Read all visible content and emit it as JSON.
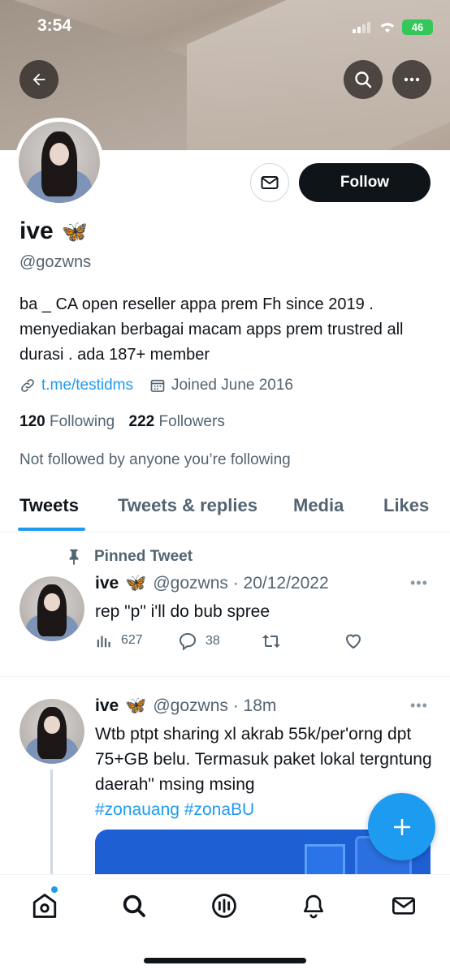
{
  "status_bar": {
    "time": "3:54",
    "battery": "46"
  },
  "profile": {
    "name": "ive",
    "name_emoji": "🦋",
    "handle": "@gozwns",
    "follow_label": "Follow",
    "bio": "ba _ CA open reseller appa prem Fh since 2019 . menyediakan berbagai macam apps prem trustred all durasi . ada 187+ member",
    "link": "t.me/testidms",
    "joined": "Joined June 2016",
    "following_count": "120",
    "following_label": "Following",
    "followers_count": "222",
    "followers_label": "Followers",
    "not_followed": "Not followed by anyone you’re following"
  },
  "tabs": [
    "Tweets",
    "Tweets & replies",
    "Media",
    "Likes"
  ],
  "tweets": [
    {
      "pinned_label": "Pinned Tweet",
      "name": "ive",
      "emoji": "🦋",
      "handle_time": "@gozwns · 20/12/2022",
      "text": "rep \"p\" i'll do bub spree",
      "views": "627",
      "replies": "38"
    },
    {
      "name": "ive",
      "emoji": "🦋",
      "handle_time": "@gozwns · 18m",
      "text": "Wtb ptpt sharing xl akrab 55k/per'orng dpt 75+GB belu. Termasuk paket lokal tergntung daerah\" msing msing",
      "hashtag1": "#zonauang",
      "hashtag2": "#zonaBU"
    }
  ],
  "icons": {
    "back": "back-arrow-icon",
    "search": "search-icon",
    "more": "more-icon",
    "mail": "mail-icon",
    "link": "link-icon",
    "calendar": "calendar-icon",
    "pin": "pin-icon",
    "compose": "plus-icon"
  },
  "colors": {
    "accent": "#1d9bf0",
    "text": "#0f1419",
    "muted": "#536471",
    "battery": "#34c759"
  }
}
